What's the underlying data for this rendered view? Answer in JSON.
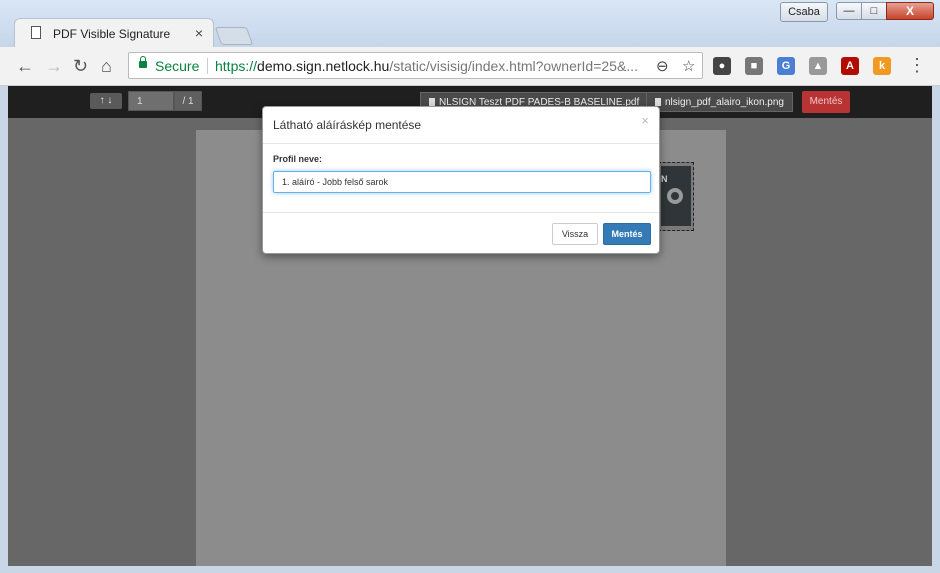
{
  "window": {
    "user_label": "Csaba",
    "minimize_glyph": "—",
    "maximize_glyph": "□",
    "close_glyph": "X"
  },
  "browser": {
    "tab_title": "PDF Visible Signature",
    "tab_close": "×",
    "back": "←",
    "forward": "→",
    "reload": "↻",
    "home": "⌂",
    "secure_label": "Secure",
    "url_scheme": "https://",
    "url_host": "demo.sign.netlock.hu",
    "url_path": "/static/visisig/index.html?ownerId=25&...",
    "zoom_icon": "⊖",
    "star_icon": "☆",
    "menu": "⋮",
    "extensions": [
      {
        "name": "lastpass-icon",
        "glyph": "●",
        "color": "#444444"
      },
      {
        "name": "screenshot-icon",
        "glyph": "■",
        "color": "#777777"
      },
      {
        "name": "translate-icon",
        "glyph": "G",
        "color": "#4a7fd3"
      },
      {
        "name": "drive-icon",
        "glyph": "▲",
        "color": "#999999"
      },
      {
        "name": "acrobat-icon",
        "glyph": "A",
        "color": "#b30b00"
      },
      {
        "name": "k-extension-icon",
        "glyph": "k",
        "color": "#f09a22"
      }
    ]
  },
  "app": {
    "page_nav_arrows": "↑ ↓",
    "page_number": "1",
    "page_total": "/ 1",
    "pdf_file": "NLSIGN Teszt PDF PADES-B BASELINE.pdf",
    "image_file": "nlsign_pdf_alairo_ikon.png",
    "save_label": "Mentés"
  },
  "signature": {
    "logo_text": "N"
  },
  "modal": {
    "title": "Látható aláíráskép mentése",
    "close": "×",
    "profile_label": "Profil neve:",
    "profile_value": "1. aláíró - Jobb felső sarok",
    "back_label": "Vissza",
    "save_label": "Mentés"
  }
}
